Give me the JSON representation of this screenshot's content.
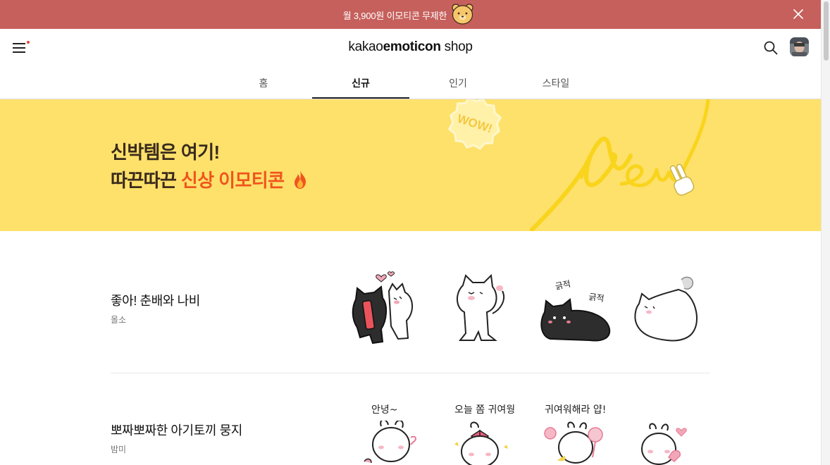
{
  "promo": {
    "text": "월 3,900원 이모티콘 무제한",
    "face_icon": "bear-face-icon",
    "close_icon": "close-icon",
    "bg_color": "#c6605c"
  },
  "header": {
    "logo_prefix": "kakao",
    "logo_bold": "emoticon",
    "logo_suffix": " shop",
    "menu_icon": "hamburger-menu-icon",
    "search_icon": "search-icon",
    "notification_dot_color": "#e5463b"
  },
  "tabs": [
    {
      "label": "홈",
      "active": false
    },
    {
      "label": "신규",
      "active": true
    },
    {
      "label": "인기",
      "active": false
    },
    {
      "label": "스타일",
      "active": false
    }
  ],
  "banner": {
    "line1": "신박템은 여기!",
    "line2_prefix": "따끈따끈 ",
    "line2_highlight": "신상 이모티콘",
    "badge_text": "WOW!",
    "art_text": "New",
    "fire_icon": "fire-icon",
    "bg_color": "#fde16b",
    "highlight_color": "#f0541e"
  },
  "products": [
    {
      "title": "좋아! 춘배와 나비",
      "author": "올소",
      "thumbs": [
        {
          "icon": "black-white-cats-hug-icon",
          "caption": ""
        },
        {
          "icon": "white-cat-giggle-icon",
          "caption": ""
        },
        {
          "icon": "black-cat-crawl-icon",
          "caption": "긁적 긁적"
        },
        {
          "icon": "white-cat-lying-icon",
          "caption": ""
        }
      ]
    },
    {
      "title": "뽀짜뽀짜한 아기토끼 뭉지",
      "author": "밤미",
      "thumbs": [
        {
          "icon": "rabbit-hello-icon",
          "caption": "안녕~"
        },
        {
          "icon": "rabbit-bow-icon",
          "caption": "오늘 쫌 귀여웡"
        },
        {
          "icon": "rabbit-lollipop-icon",
          "caption": "귀여워해라 얍!"
        },
        {
          "icon": "rabbit-heart-icon",
          "caption": ""
        }
      ]
    }
  ]
}
